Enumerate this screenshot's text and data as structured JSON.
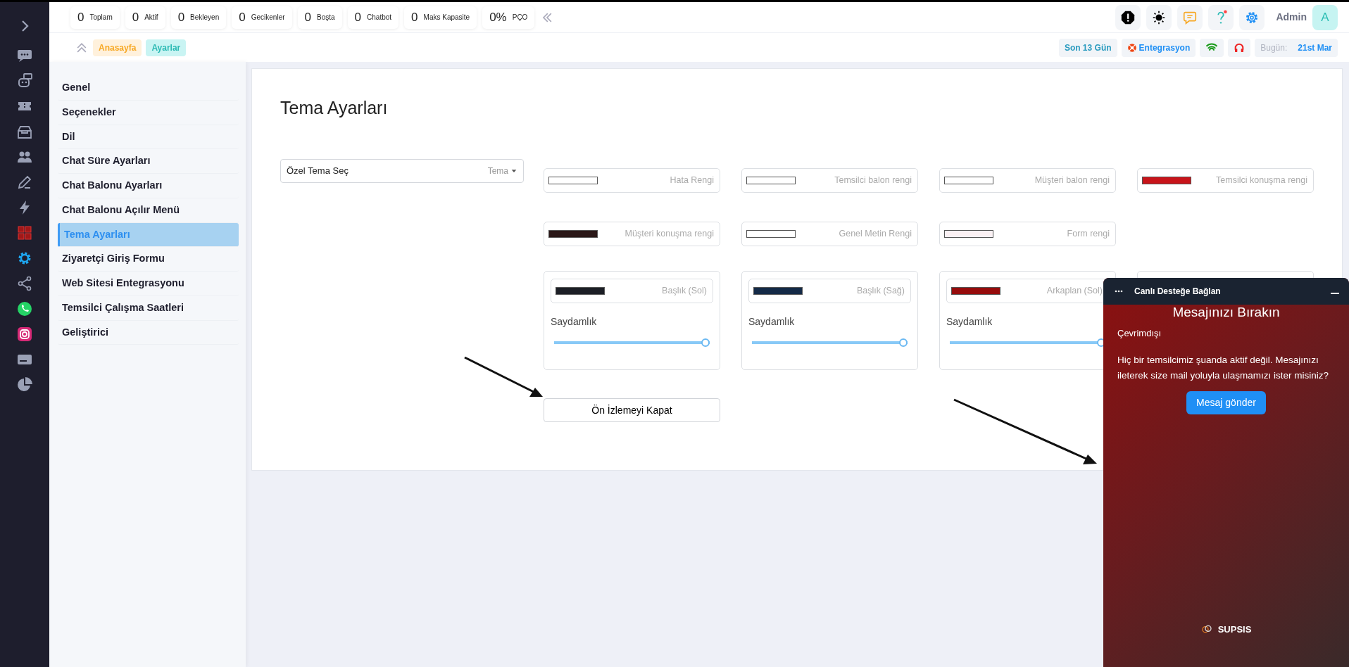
{
  "nav_rail": [
    {
      "kind": "expand",
      "selected": false
    },
    {
      "kind": "chat",
      "selected": false
    },
    {
      "kind": "robot",
      "selected": false
    },
    {
      "kind": "ticket",
      "selected": false
    },
    {
      "kind": "inbox",
      "selected": false
    },
    {
      "kind": "users",
      "selected": false
    },
    {
      "kind": "pen",
      "selected": false
    },
    {
      "kind": "bolt",
      "selected": false
    },
    {
      "kind": "grid",
      "selected": false
    },
    {
      "kind": "gear",
      "selected": true
    },
    {
      "kind": "share",
      "selected": false
    },
    {
      "kind": "whatsapp",
      "selected": false
    },
    {
      "kind": "instagram",
      "selected": false
    },
    {
      "kind": "card",
      "selected": false
    },
    {
      "kind": "pie",
      "selected": false
    }
  ],
  "stats": [
    {
      "value": "0",
      "label": "Toplam"
    },
    {
      "value": "0",
      "label": "Aktif"
    },
    {
      "value": "0",
      "label": "Bekleyen"
    },
    {
      "value": "0",
      "label": "Gecikenler"
    },
    {
      "value": "0",
      "label": "Boşta"
    },
    {
      "value": "0",
      "label": "Chatbot"
    },
    {
      "value": "0",
      "label": "Maks Kapasite"
    },
    {
      "value": "0%",
      "label": "PÇO"
    }
  ],
  "user": {
    "name": "Admin",
    "avatar": "A"
  },
  "breadcrumb": [
    {
      "label": "Anasayfa",
      "kind": "home"
    },
    {
      "label": "Ayarlar",
      "kind": "current"
    }
  ],
  "status": {
    "range": "Son 13 Gün",
    "integration": "Entegrasyon",
    "date_label": "Bugün:",
    "date": "21st Mar"
  },
  "settings_menu": [
    {
      "label": "Genel",
      "selected": false
    },
    {
      "label": "Seçenekler",
      "selected": false
    },
    {
      "label": "Dil",
      "selected": false
    },
    {
      "label": "Chat Süre Ayarları",
      "selected": false
    },
    {
      "label": "Chat Balonu Ayarları",
      "selected": false
    },
    {
      "label": "Chat Balonu Açılır Menü",
      "selected": false
    },
    {
      "label": "Tema Ayarları",
      "selected": true
    },
    {
      "label": "Ziyaretçi Giriş Formu",
      "selected": false
    },
    {
      "label": "Web Sitesi Entegrasyonu",
      "selected": false
    },
    {
      "label": "Temsilci Çalışma Saatleri",
      "selected": false
    },
    {
      "label": "Geliştirici",
      "selected": false
    }
  ],
  "page_title": "Tema Ayarları",
  "theme_select": {
    "value": "Özel Tema Seç",
    "addon": "Tema"
  },
  "color_fields": [
    {
      "label": "Hata Rengi",
      "color": "#ffffff"
    },
    {
      "label": "Temsilci balon rengi",
      "color": "#ffffff"
    },
    {
      "label": "Müşteri balon rengi",
      "color": "#ffffff"
    },
    {
      "label": "Temsilci konuşma rengi",
      "color": "#c8141a"
    },
    {
      "label": "Müşteri konuşma rengi",
      "color": "#2a1717"
    },
    {
      "label": "Genel Metin Rengi",
      "color": "#ffffff"
    },
    {
      "label": "Form rengi",
      "color": "#fbf1f4"
    }
  ],
  "opacity_cards": [
    {
      "label": "Başlık (Sol)",
      "color": "#1c1f26",
      "opacity_label": "Saydamlık",
      "level": 1
    },
    {
      "label": "Başlık (Sağ)",
      "color": "#142a47",
      "opacity_label": "Saydamlık",
      "level": 1
    },
    {
      "label": "Arkaplan (Sol)",
      "color": "#960c0c",
      "opacity_label": "Saydamlık",
      "level": 1
    }
  ],
  "preview_button": "Ön İzlemeyi Kapat",
  "chat_widget": {
    "header": "Canlı Desteğe Bağlan",
    "title": "Mesajınızı Bırakın",
    "status": "Çevrimdışı",
    "message": "Hiç bir temsilcimiz şuanda aktif değil. Mesajınızı ileterek size mail yoluyla ulaşmamızı ister misiniz?",
    "button": "Mesaj gönder",
    "brand": "SUPSIS"
  }
}
